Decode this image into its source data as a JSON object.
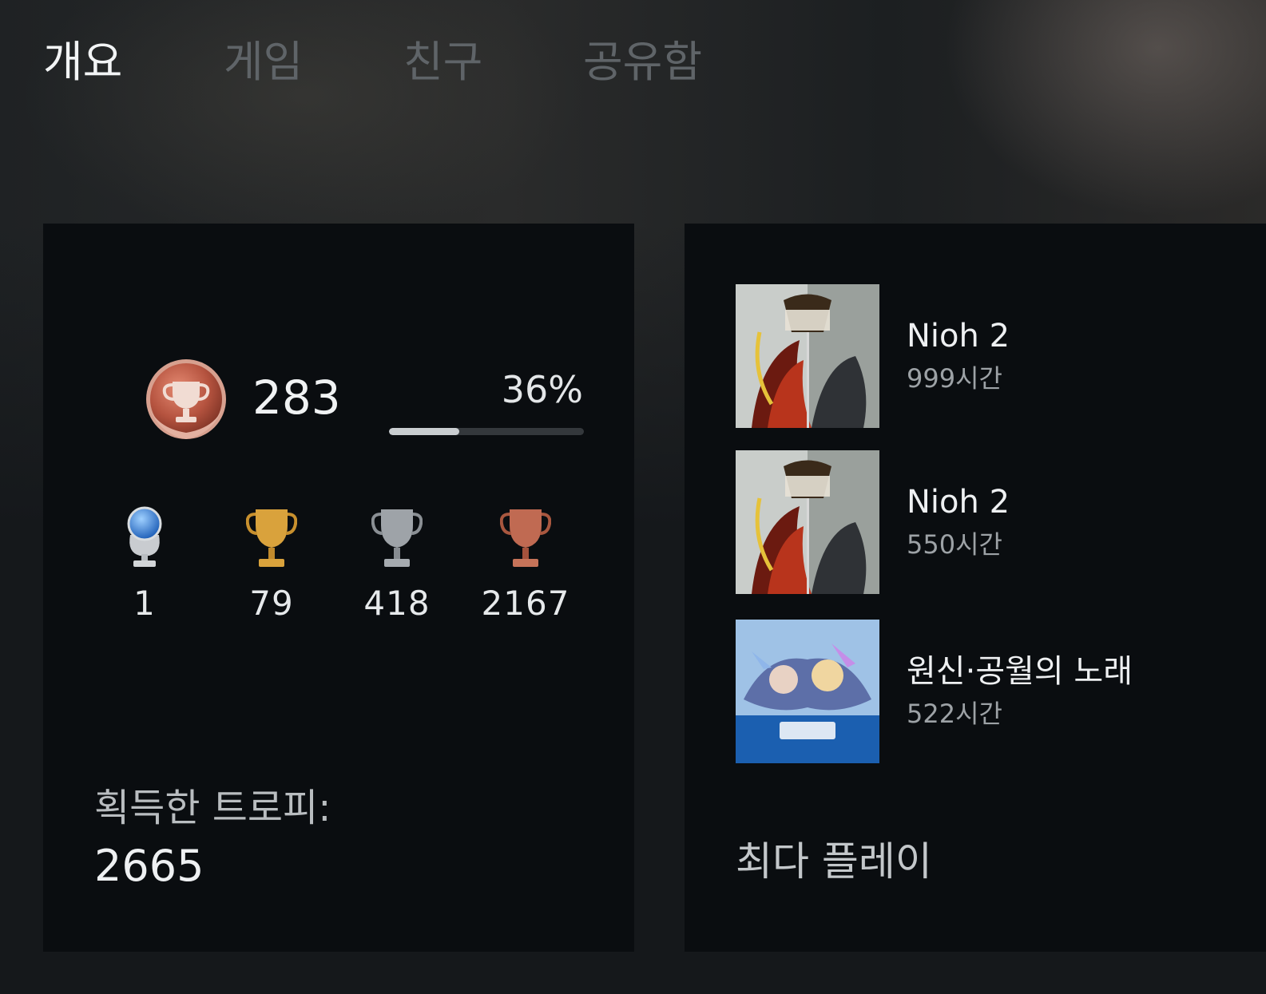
{
  "tabs": [
    {
      "label": "개요",
      "active": true
    },
    {
      "label": "게임",
      "active": false
    },
    {
      "label": "친구",
      "active": false
    },
    {
      "label": "공유함",
      "active": false
    }
  ],
  "trophy_summary": {
    "level": "283",
    "level_progress_text": "36%",
    "level_progress_fraction": 0.36,
    "level_badge_icon": "bronze-level-trophy-icon",
    "counts": [
      {
        "type": "platinum",
        "icon": "platinum-trophy-icon",
        "value": "1",
        "color": "#6aa0d8"
      },
      {
        "type": "gold",
        "icon": "gold-trophy-icon",
        "value": "79",
        "color": "#d6a23a"
      },
      {
        "type": "silver",
        "icon": "silver-trophy-icon",
        "value": "418",
        "color": "#9ea3a8"
      },
      {
        "type": "bronze",
        "icon": "bronze-trophy-icon",
        "value": "2167",
        "color": "#c06a52"
      }
    ],
    "earned_label": "획득한 트로피:",
    "earned_total": "2665"
  },
  "most_played": {
    "games": [
      {
        "title": "Nioh 2",
        "time": "999시간",
        "cover_icon": "nioh2-cover"
      },
      {
        "title": "Nioh 2",
        "time": "550시간",
        "cover_icon": "nioh2-cover"
      },
      {
        "title": "원신·공월의 노래",
        "time": "522시간",
        "cover_icon": "genshin-cover"
      }
    ],
    "section_title": "최다 플레이"
  }
}
